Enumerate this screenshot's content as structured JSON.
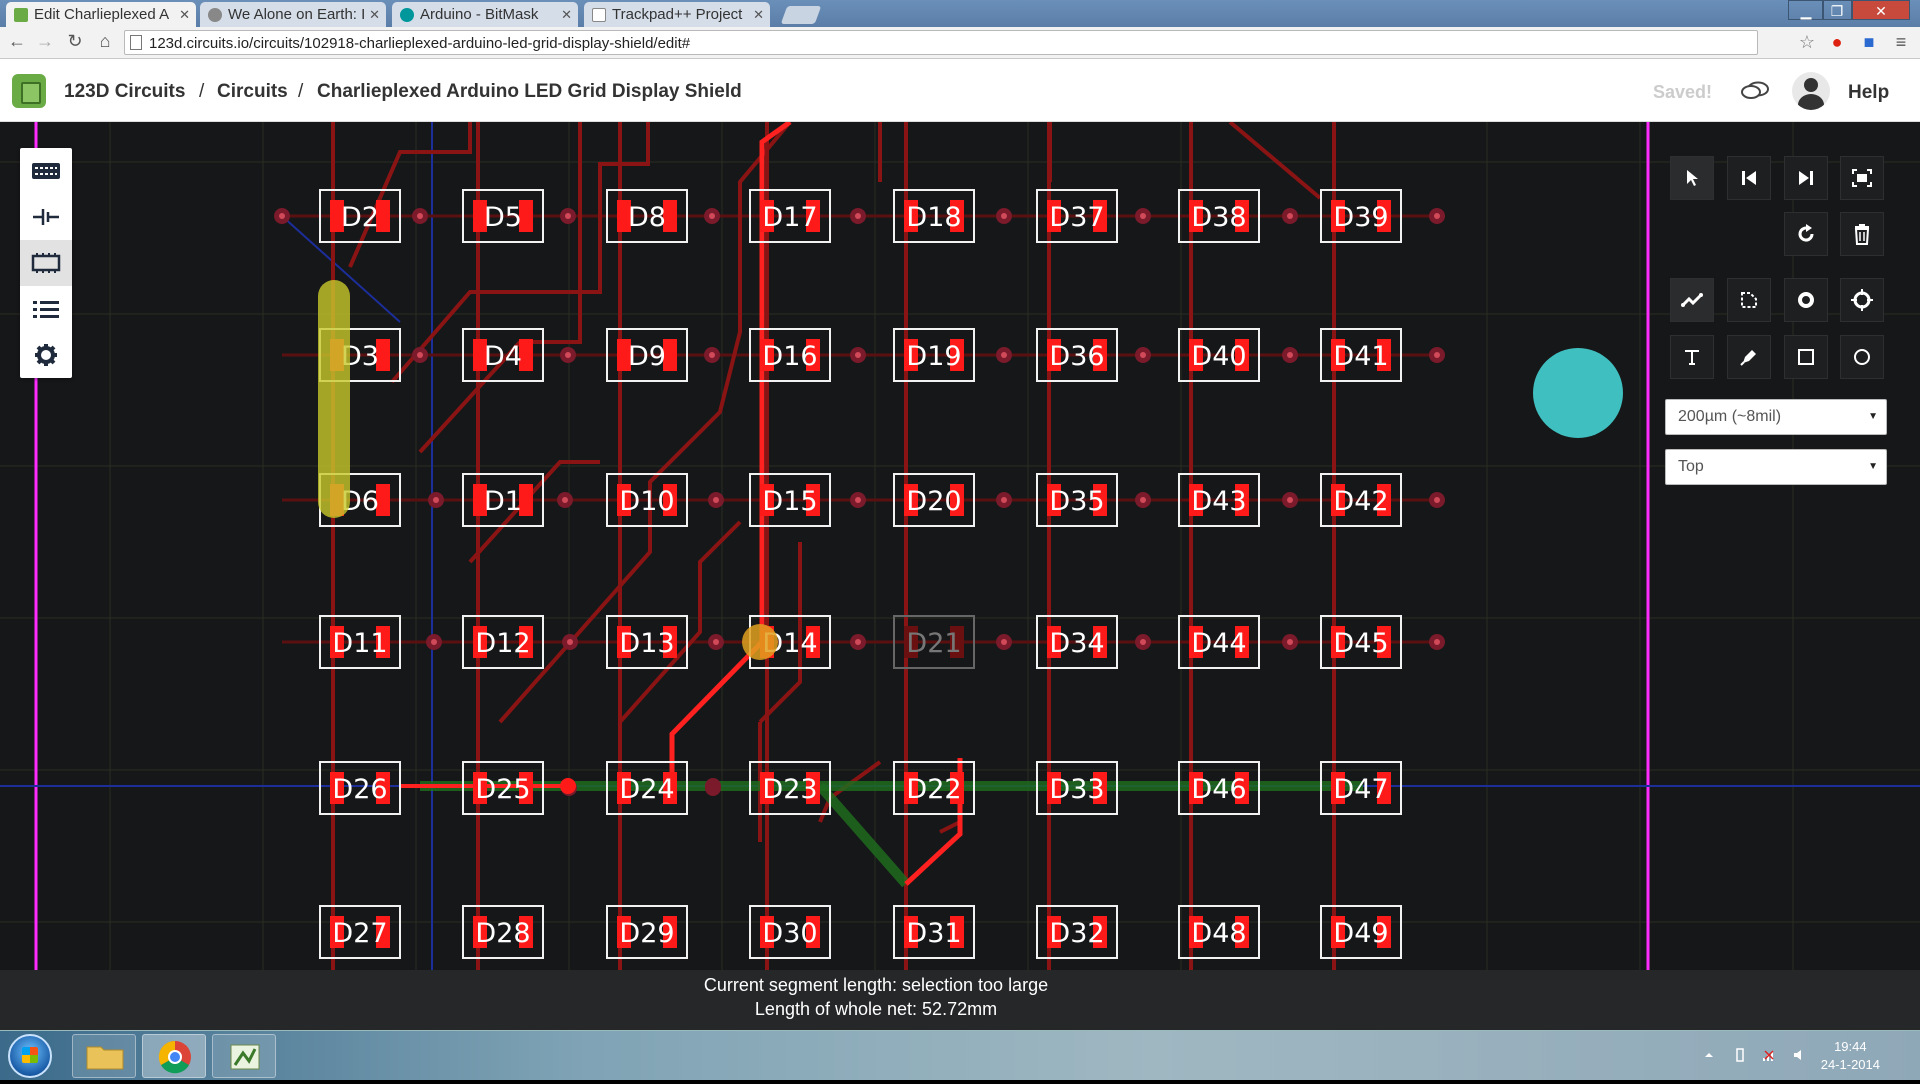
{
  "browser": {
    "tabs": [
      {
        "title": "Edit Charlieplexed A",
        "active": true,
        "favicon_color": "#6bab45"
      },
      {
        "title": "We Alone on Earth: I",
        "active": false,
        "favicon_color": "#666666"
      },
      {
        "title": "Arduino - BitMask",
        "active": false,
        "favicon_color": "#00979c"
      },
      {
        "title": "Trackpad++ Project",
        "active": false,
        "favicon_color": "#ffffff"
      }
    ],
    "url": "123d.circuits.io/circuits/102918-charlieplexed-arduino-led-grid-display-shield/edit#"
  },
  "header": {
    "crumbs": [
      "123D Circuits",
      "Circuits",
      "Charlieplexed Arduino LED Grid Display Shield"
    ],
    "separator": "/",
    "saved": "Saved!",
    "help": "Help"
  },
  "left_toolbar": {
    "tools": [
      {
        "name": "breadboard-view",
        "icon": "breadboard-icon"
      },
      {
        "name": "schematic-view",
        "icon": "schematic-icon"
      },
      {
        "name": "pcb-view",
        "icon": "pcb-icon",
        "selected": true
      },
      {
        "name": "component-list",
        "icon": "list-icon"
      },
      {
        "name": "settings",
        "icon": "gear-icon"
      }
    ]
  },
  "right_panel": {
    "trace_width": "200µm (~8mil)",
    "layer": "Top"
  },
  "pcb": {
    "rows": [
      [
        "D2",
        "D5",
        "D8",
        "D17",
        "D18",
        "D37",
        "D38",
        "D39"
      ],
      [
        "D3",
        "D4",
        "D9",
        "D16",
        "D19",
        "D36",
        "D40",
        "D41"
      ],
      [
        "D6",
        "D1",
        "D10",
        "D15",
        "D20",
        "D35",
        "D43",
        "D42"
      ],
      [
        "D11",
        "D12",
        "D13",
        "D14",
        "D21",
        "D34",
        "D44",
        "D45"
      ],
      [
        "D26",
        "D25",
        "D24",
        "D23",
        "D22",
        "D33",
        "D46",
        "D47"
      ],
      [
        "D27",
        "D28",
        "D29",
        "D30",
        "D31",
        "D32",
        "D48",
        "D49"
      ]
    ],
    "dimmed": [
      "D21"
    ],
    "colors": {
      "trace": "#cc1a1a",
      "highlight_trace": "#ff2020",
      "pad": "#ff1a1a",
      "selected_net": "#1e6b1e",
      "selection_marker": "#c8c82a",
      "board_edge": "#ff2bff",
      "background": "#161719"
    }
  },
  "status": {
    "segment": "Current segment length: selection too large",
    "net": "Length of whole net: 52.72mm"
  },
  "taskbar": {
    "time": "19:44",
    "date": "24-1-2014"
  }
}
